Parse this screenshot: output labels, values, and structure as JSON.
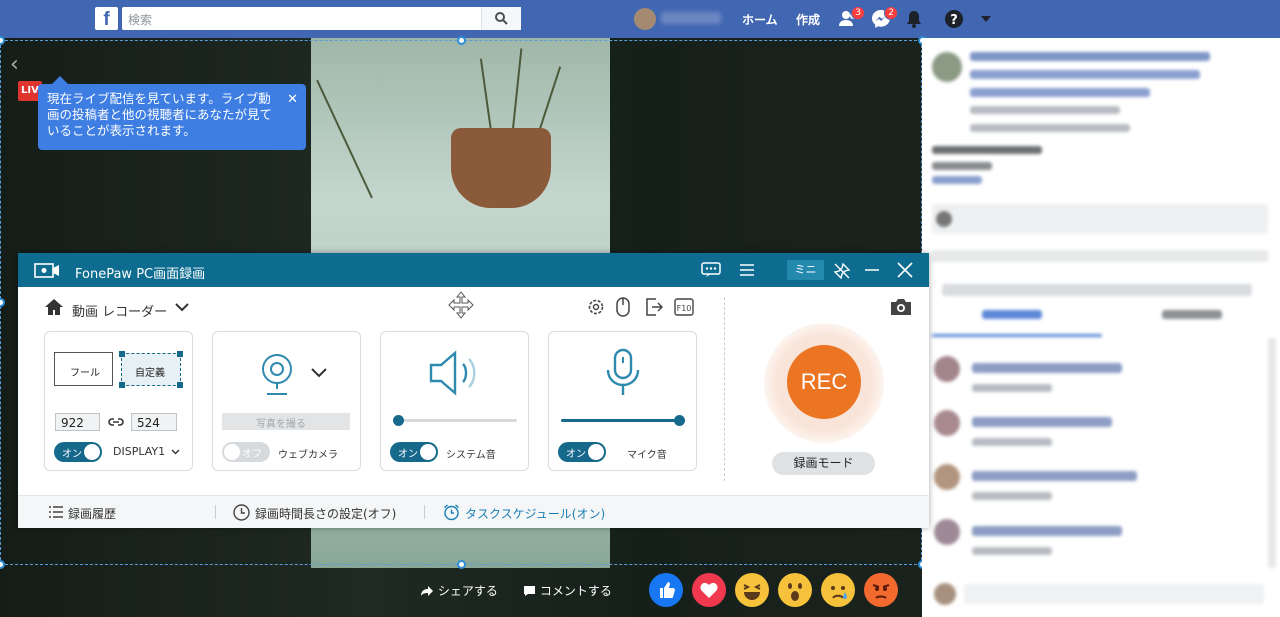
{
  "facebook": {
    "logo": "f",
    "search_placeholder": "検索",
    "nav": {
      "home": "ホーム",
      "create": "作成"
    },
    "badges": {
      "friends": "3",
      "messages": "2"
    }
  },
  "video": {
    "live_badge": "LIVE",
    "tooltip": "現在ライブ配信を見ています。ライブ動画の投稿者と他の視聴者にあなたが見ていることが表示されます。",
    "share": "シェアする",
    "comment": "コメントする"
  },
  "recorder": {
    "title": "FonePaw PC画面録画",
    "mini": "ミニ",
    "mode": "動画 レコーダー",
    "region": {
      "full": "フール",
      "custom": "自定義",
      "width": "922",
      "height": "524",
      "toggle": "オン",
      "display": "DISPLAY1"
    },
    "webcam": {
      "photo": "写真を撮る",
      "toggle": "オフ",
      "label": "ウェブカメラ"
    },
    "system": {
      "toggle": "オン",
      "label": "システム音",
      "volume_pct": 4
    },
    "mic": {
      "toggle": "オン",
      "label": "マイク音",
      "volume_pct": 100
    },
    "rec": "REC",
    "record_mode": "録画モード",
    "footer": {
      "history": "録画履歴",
      "duration": "録画時間長さの設定(オフ)",
      "schedule": "タスクスケジュール(オン)"
    },
    "colors": {
      "accent": "#0d6c8f",
      "rec": "#ec7524",
      "link": "#1b7fb6"
    }
  }
}
